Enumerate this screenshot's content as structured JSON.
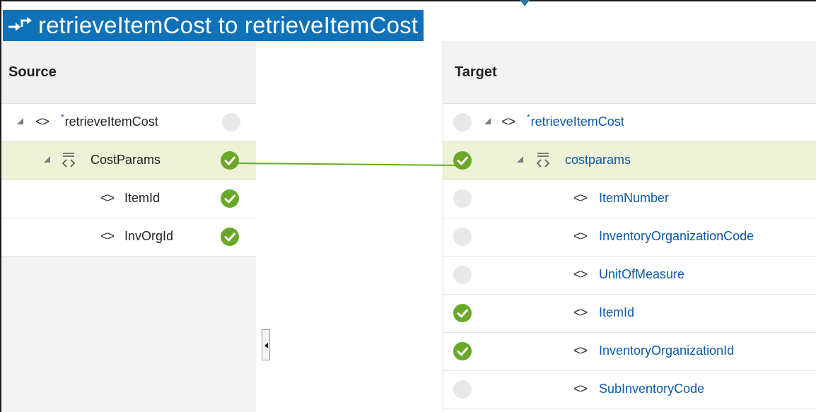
{
  "title": "retrieveItemCost to retrieveItemCost",
  "source": {
    "header": "Source",
    "nodes": [
      {
        "label": "retrieveItemCost",
        "required": true,
        "type": "element",
        "expanded": true,
        "mapped": false
      },
      {
        "label": "CostParams",
        "type": "collection",
        "expanded": true,
        "mapped": true,
        "selected": true
      },
      {
        "label": "ItemId",
        "type": "element",
        "mapped": true
      },
      {
        "label": "InvOrgId",
        "type": "element",
        "mapped": true
      }
    ]
  },
  "target": {
    "header": "Target",
    "nodes": [
      {
        "label": "retrieveItemCost",
        "required": true,
        "type": "element",
        "expanded": true,
        "mapped": false
      },
      {
        "label": "costparams",
        "type": "collection",
        "expanded": true,
        "mapped": true,
        "selected": true
      },
      {
        "label": "ItemNumber",
        "type": "element",
        "mapped": false
      },
      {
        "label": "InventoryOrganizationCode",
        "type": "element",
        "mapped": false
      },
      {
        "label": "UnitOfMeasure",
        "type": "element",
        "mapped": false
      },
      {
        "label": "ItemId",
        "type": "element",
        "mapped": true
      },
      {
        "label": "InventoryOrganizationId",
        "type": "element",
        "mapped": true
      },
      {
        "label": "SubInventoryCode",
        "type": "element",
        "mapped": false
      }
    ]
  },
  "icons": {
    "title": "map-arrows-icon",
    "element": "element-code-icon",
    "collection": "collection-code-icon",
    "expand": "expanded-triangle-icon",
    "mapped": "check-circle-icon",
    "unmapped": "empty-circle-icon"
  },
  "colors": {
    "title_bg": "#0f71b8",
    "mapped_green": "#6aa829",
    "selected_row": "#edf1d5",
    "target_text": "#0b5aa6"
  }
}
